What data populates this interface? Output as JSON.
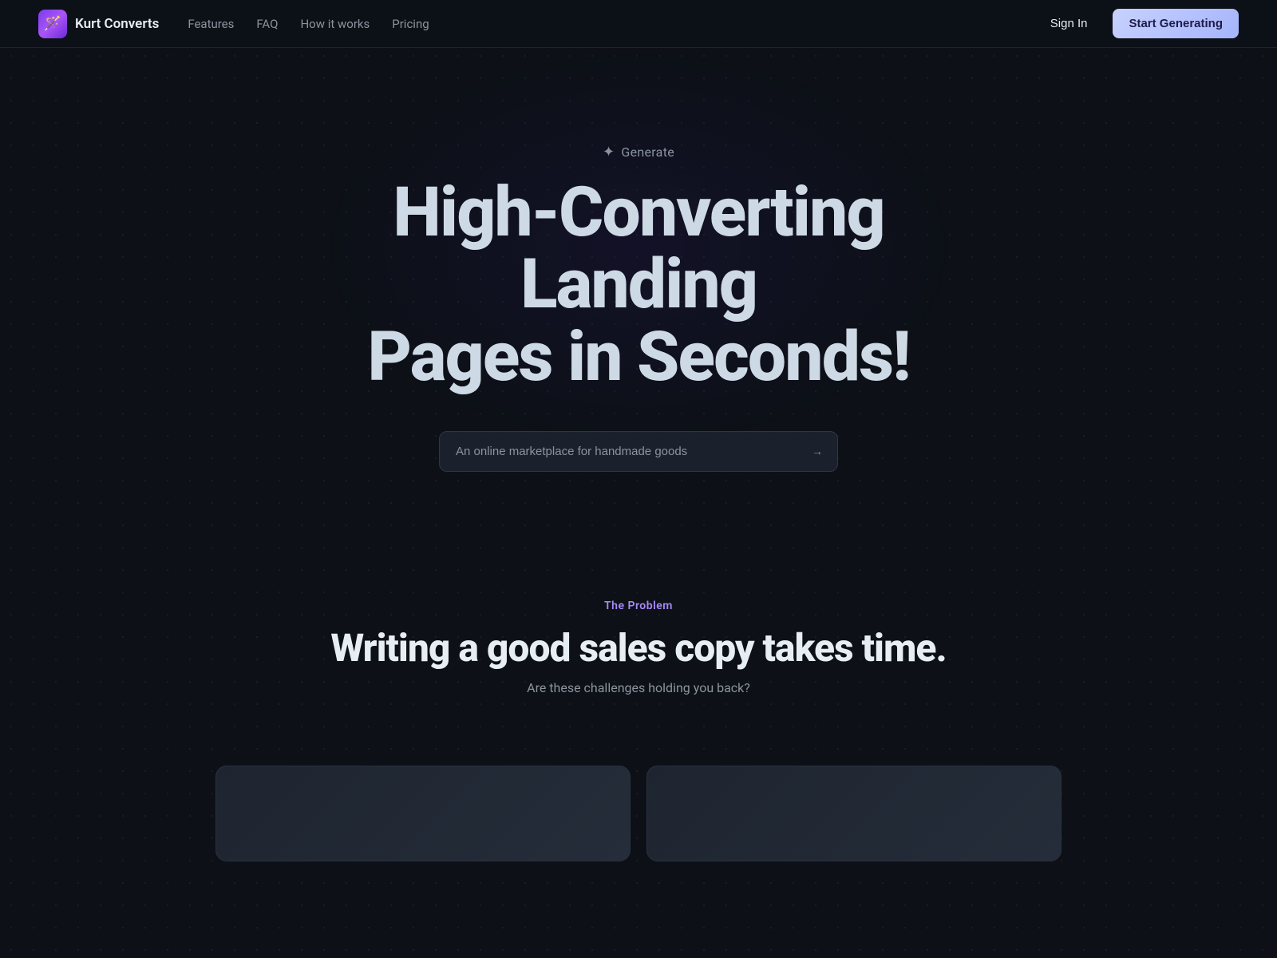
{
  "brand": {
    "logo_emoji": "🪄",
    "name": "Kurt Converts"
  },
  "nav": {
    "links": [
      {
        "label": "Features",
        "href": "#"
      },
      {
        "label": "FAQ",
        "href": "#"
      },
      {
        "label": "How it works",
        "href": "#"
      },
      {
        "label": "Pricing",
        "href": "#"
      }
    ],
    "sign_in_label": "Sign In",
    "start_label": "Start Generating"
  },
  "hero": {
    "generate_label": "Generate",
    "title_line1": "High-Converting Landing",
    "title_line2": "Pages in Seconds!",
    "input_value": "An online marketplace for handmade goods",
    "input_placeholder": "An online marketplace for handmade goods"
  },
  "problem": {
    "eyebrow": "The Problem",
    "title": "Writing a good sales copy takes time.",
    "subtitle": "Are these challenges holding you back?"
  },
  "icons": {
    "sparkle": "✦",
    "arrow_right": "→"
  }
}
